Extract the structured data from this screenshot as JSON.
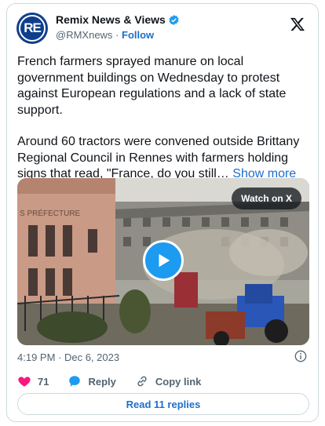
{
  "author": {
    "display_name": "Remix News & Views",
    "handle": "@RMXnews",
    "separator": " · ",
    "follow_label": "Follow",
    "avatar_text": "RE"
  },
  "tweet": {
    "paragraph1": "French farmers sprayed manure on local government buildings on Wednesday to protest against European regulations and a lack of state support.",
    "paragraph2": "Around 60 tractors were convened outside Brittany Regional Council in Rennes with farmers holding signs that read, \"France, do you still…",
    "show_more": "Show more"
  },
  "media": {
    "watch_label": "Watch on X",
    "sign_text": "S PRÉFECTURE"
  },
  "meta": {
    "timestamp": "4:19 PM · Dec 6, 2023"
  },
  "actions": {
    "likes": "71",
    "reply_label": "Reply",
    "copy_link_label": "Copy link"
  },
  "replies_button": "Read 11 replies",
  "colors": {
    "accent": "#1d9bf0",
    "link": "#1d6fcb",
    "heart": "#f91880"
  }
}
